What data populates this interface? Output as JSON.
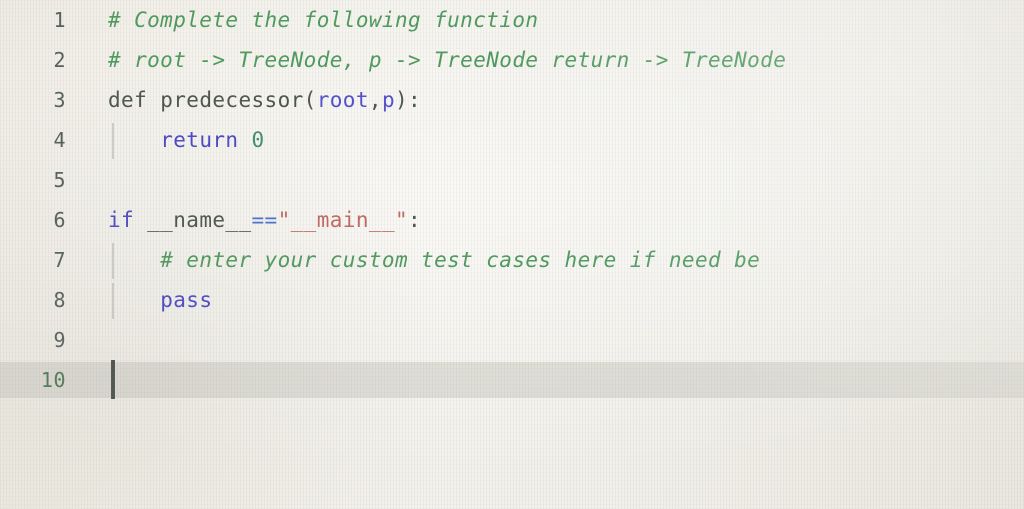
{
  "editor": {
    "language": "python",
    "colors": {
      "background": "#f2efe7",
      "comment": "#4e9a5e",
      "keyword": "#4a47c8",
      "string": "#c06a62",
      "number": "#3f8f6f",
      "identifier": "#4d544f",
      "parameter": "#5150cf",
      "operator": "#4a6fcf",
      "gutter_text": "#56605a",
      "active_line_highlight": "#c9c8c0",
      "caret": "#4a4f4a"
    },
    "active_line_number": 10,
    "caret": {
      "line": 10,
      "column": 1
    },
    "lines": [
      {
        "number": "1",
        "indent_guide": false,
        "tokens": [
          {
            "text": "# Complete the following function",
            "type": "comment"
          }
        ]
      },
      {
        "number": "2",
        "indent_guide": false,
        "tokens": [
          {
            "text": "# root -> TreeNode, p -> TreeNode return -> TreeNode",
            "type": "comment"
          }
        ]
      },
      {
        "number": "3",
        "indent_guide": false,
        "tokens": [
          {
            "text": "def",
            "type": "def"
          },
          {
            "text": " ",
            "type": "plain"
          },
          {
            "text": "predecessor",
            "type": "name"
          },
          {
            "text": "(",
            "type": "punct"
          },
          {
            "text": "root",
            "type": "param"
          },
          {
            "text": ",",
            "type": "punct"
          },
          {
            "text": "p",
            "type": "param"
          },
          {
            "text": "):",
            "type": "punct"
          }
        ]
      },
      {
        "number": "4",
        "indent_guide": true,
        "tokens": [
          {
            "text": "    ",
            "type": "plain"
          },
          {
            "text": "return",
            "type": "keyword"
          },
          {
            "text": " ",
            "type": "plain"
          },
          {
            "text": "0",
            "type": "number"
          }
        ]
      },
      {
        "number": "5",
        "indent_guide": false,
        "tokens": []
      },
      {
        "number": "6",
        "indent_guide": false,
        "tokens": [
          {
            "text": "if",
            "type": "keyword"
          },
          {
            "text": " ",
            "type": "plain"
          },
          {
            "text": "__name__",
            "type": "name"
          },
          {
            "text": "==",
            "type": "operator"
          },
          {
            "text": "\"__main__\"",
            "type": "string"
          },
          {
            "text": ":",
            "type": "punct"
          }
        ]
      },
      {
        "number": "7",
        "indent_guide": true,
        "tokens": [
          {
            "text": "    ",
            "type": "plain"
          },
          {
            "text": "# enter your custom test cases here if need be",
            "type": "comment"
          }
        ]
      },
      {
        "number": "8",
        "indent_guide": true,
        "tokens": [
          {
            "text": "    ",
            "type": "plain"
          },
          {
            "text": "pass",
            "type": "keyword"
          }
        ]
      },
      {
        "number": "9",
        "indent_guide": false,
        "tokens": []
      },
      {
        "number": "10",
        "indent_guide": false,
        "tokens": []
      }
    ]
  }
}
